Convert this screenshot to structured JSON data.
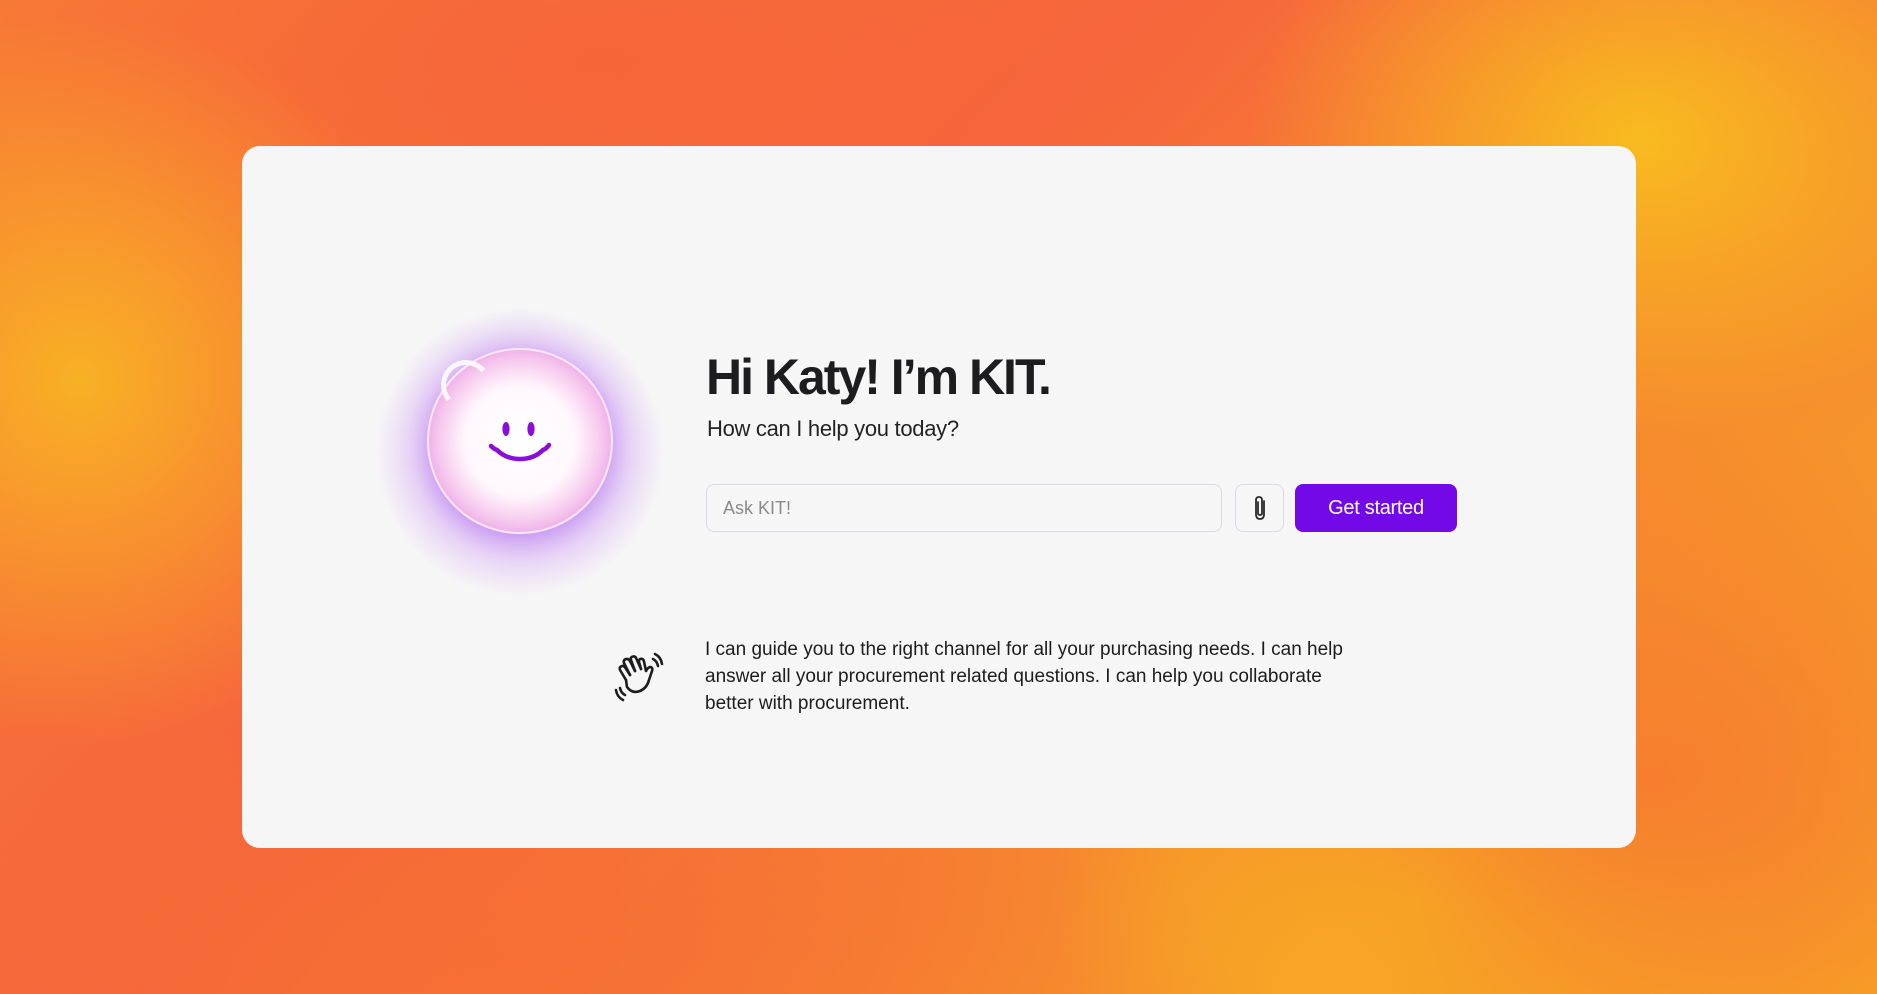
{
  "greeting": {
    "title": "Hi Katy! I’m KIT.",
    "subtitle": "How can I help you today?"
  },
  "ask": {
    "placeholder": "Ask KIT!",
    "value": ""
  },
  "actions": {
    "attach_icon": "paperclip-icon",
    "get_started_label": "Get started"
  },
  "info": {
    "icon": "waving-hand-icon",
    "text": "I can guide you to the right channel for all your purchasing needs. I can help answer all your procurement related questions. I can help you collaborate better with procurement."
  },
  "colors": {
    "accent": "#7209e6",
    "card_background": "#f6f6f6",
    "text": "#1d1d1f"
  }
}
